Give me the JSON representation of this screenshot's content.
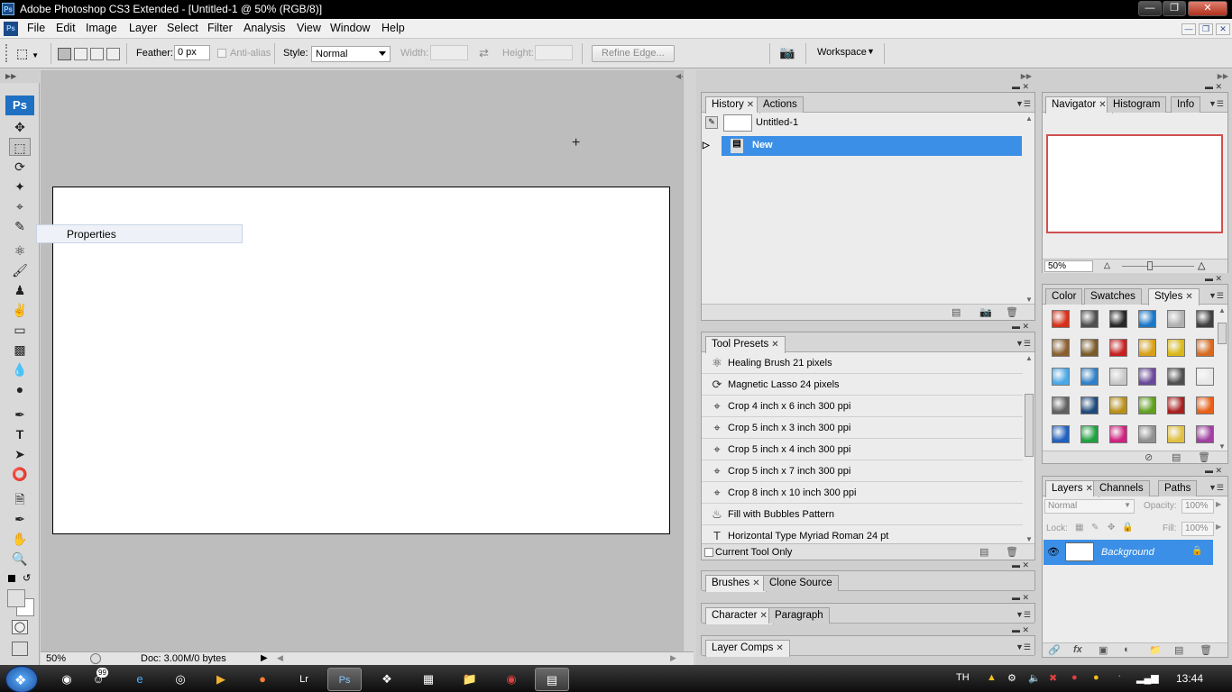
{
  "window": {
    "title": "Adobe Photoshop CS3 Extended - [Untitled-1 @ 50% (RGB/8)]",
    "app_icon": "Ps",
    "controls": [
      "minimize-icon",
      "maximize-icon",
      "close-icon"
    ]
  },
  "menu": {
    "items": [
      "File",
      "Edit",
      "Image",
      "Layer",
      "Select",
      "Filter",
      "Analysis",
      "View",
      "Window",
      "Help"
    ]
  },
  "options": {
    "feather_label": "Feather:",
    "feather_value": "0 px",
    "antialias_label": "Anti-alias",
    "style_label": "Style:",
    "style_value": "Normal",
    "width_label": "Width:",
    "height_label": "Height:",
    "refine_edge": "Refine Edge...",
    "workspace": "Workspace"
  },
  "toolbox": {
    "logo": "Ps"
  },
  "context": {
    "properties": "Properties"
  },
  "status": {
    "zoom": "50%",
    "doc": "Doc: 3.00M/0 bytes"
  },
  "history_panel": {
    "tabs": [
      "History",
      "Actions"
    ],
    "snapshot": "Untitled-1",
    "state": "New"
  },
  "presets_panel": {
    "tab": "Tool Presets",
    "items": [
      {
        "icon": "healing-brush-icon",
        "label": "Healing Brush 21 pixels"
      },
      {
        "icon": "magnetic-lasso-icon",
        "label": "Magnetic Lasso 24 pixels"
      },
      {
        "icon": "crop-icon",
        "label": "Crop 4 inch x 6 inch 300 ppi"
      },
      {
        "icon": "crop-icon",
        "label": "Crop 5 inch x 3 inch 300 ppi"
      },
      {
        "icon": "crop-icon",
        "label": "Crop 5 inch x 4 inch 300 ppi"
      },
      {
        "icon": "crop-icon",
        "label": "Crop 5 inch x 7 inch 300 ppi"
      },
      {
        "icon": "crop-icon",
        "label": "Crop 8 inch x 10 inch 300 ppi"
      },
      {
        "icon": "paint-bucket-icon",
        "label": "Fill with Bubbles Pattern"
      },
      {
        "icon": "type-icon",
        "label": "Horizontal Type Myriad Roman 24 pt"
      }
    ],
    "current_tool_only": "Current Tool Only"
  },
  "collapsed_panels": {
    "brushes": [
      "Brushes",
      "Clone Source"
    ],
    "character": [
      "Character",
      "Paragraph"
    ],
    "layer_comps": [
      "Layer Comps"
    ]
  },
  "navigator_panel": {
    "tabs": [
      "Navigator",
      "Histogram",
      "Info"
    ],
    "zoom": "50%"
  },
  "styles_panel": {
    "tabs": [
      "Color",
      "Swatches",
      "Styles"
    ],
    "swatch_colors": [
      "#d83018",
      "#505050",
      "#282828",
      "#1a78c8",
      "#b0b0b0",
      "#404040",
      "#8a6030",
      "#7a5a28",
      "#c82020",
      "#d8a018",
      "#d8b818",
      "#d86a20",
      "#4aa8e8",
      "#3080c8",
      "#c8c8c8",
      "#6a4a9a",
      "#505050",
      "#e8e8e8",
      "#606060",
      "#204a7a",
      "#b89018",
      "#60a020",
      "#a82020",
      "#e86018",
      "#2060c0",
      "#20a040",
      "#d02080",
      "#909090",
      "#e0c040",
      "#a040a0"
    ]
  },
  "layers_panel": {
    "tabs": [
      "Layers",
      "Channels",
      "Paths"
    ],
    "blend_mode": "Normal",
    "opacity_label": "Opacity:",
    "opacity_value": "100%",
    "lock_label": "Lock:",
    "fill_label": "Fill:",
    "fill_value": "100%",
    "layer_name": "Background"
  },
  "taskbar": {
    "badge": "99",
    "lang": "TH",
    "clock": "13:44",
    "apps": [
      "chrome-icon",
      "media-icon",
      "firefox-icon",
      "lightroom-icon",
      "photoshop-icon",
      "app-icon",
      "paint-icon",
      "folder-icon",
      "media-player-icon",
      "winrar-icon"
    ]
  }
}
